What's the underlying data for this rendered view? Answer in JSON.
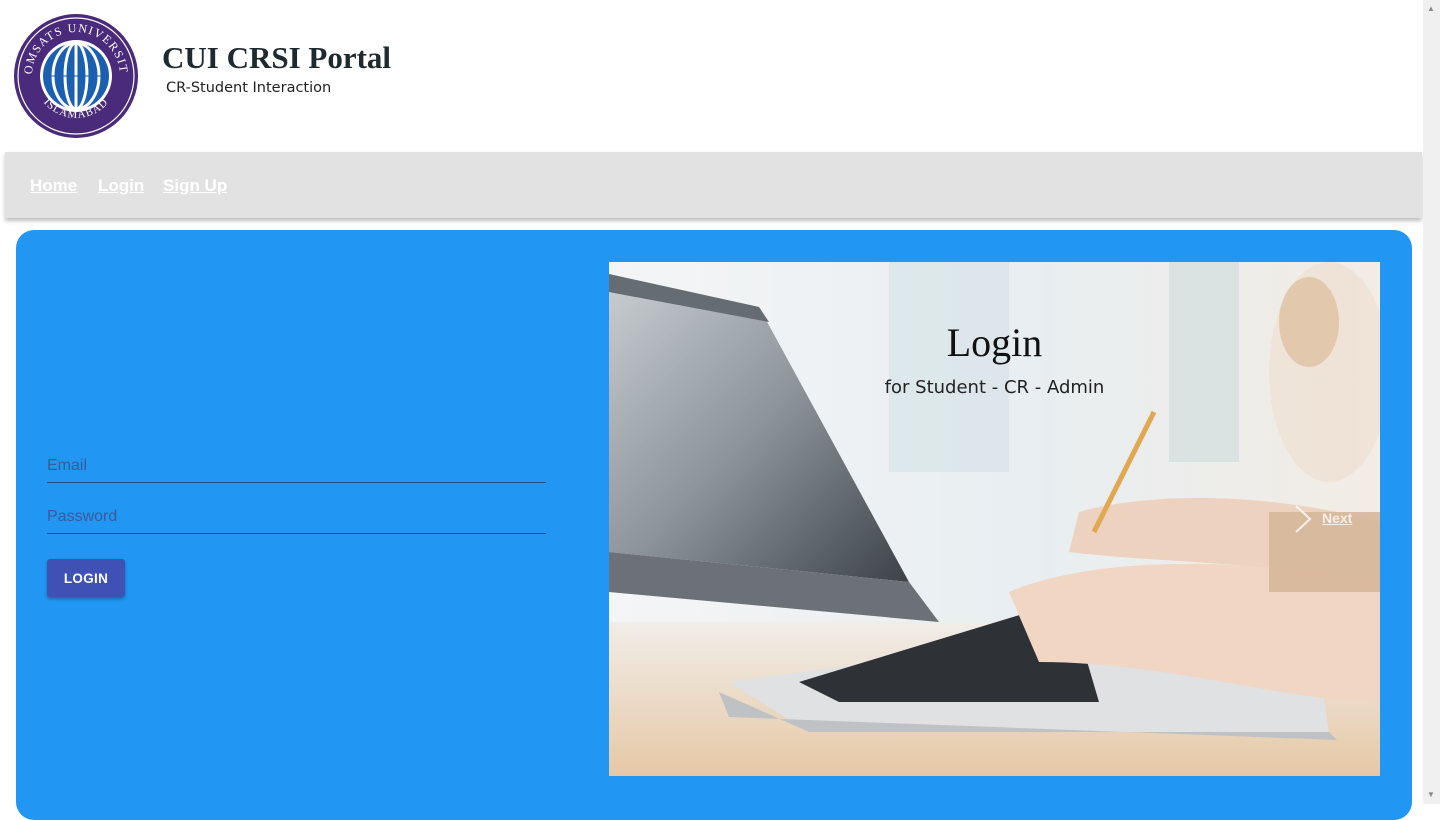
{
  "header": {
    "title": "CUI CRSI Portal",
    "subtitle": "CR-Student Interaction",
    "logo": {
      "ring_text_top": "COMSATS UNIVERSITY",
      "ring_text_bottom": "ISLAMABAD",
      "ring_color": "#4a2a7a",
      "globe_color": "#1a5fb0"
    }
  },
  "nav": {
    "items": [
      {
        "label": "Home"
      },
      {
        "label": "Login"
      },
      {
        "label": "Sign Up"
      }
    ]
  },
  "form": {
    "email_placeholder": "Email",
    "password_placeholder": "Password",
    "login_button": "LOGIN"
  },
  "carousel": {
    "title": "Login",
    "subtitle": "for Student - CR - Admin",
    "next_label": "Next",
    "next_icon": "chevron-right-icon"
  },
  "colors": {
    "panel_bg": "#2196f3",
    "navbar_bg": "#e2e2e2",
    "button_bg": "#3f51b5"
  }
}
